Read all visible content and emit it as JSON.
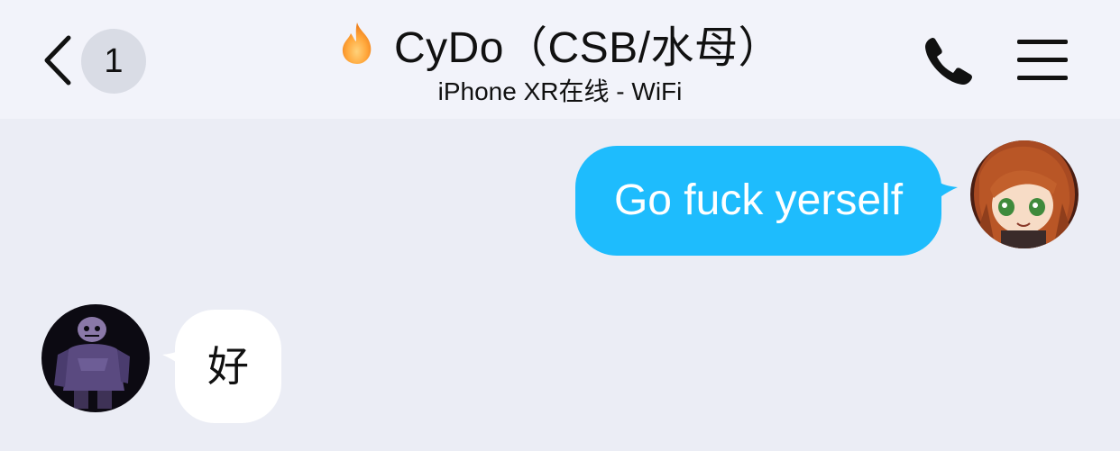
{
  "header": {
    "unread_count": "1",
    "contact_name": "CyDo（CSB/水母）",
    "status": "iPhone XR在线 - WiFi",
    "icons": {
      "back": "chevron-left-icon",
      "title_badge": "fire-icon",
      "call": "phone-icon",
      "menu": "hamburger-menu-icon"
    }
  },
  "messages": [
    {
      "sender": "me",
      "text": "Go fuck yerself"
    },
    {
      "sender": "other",
      "text": "好"
    }
  ],
  "colors": {
    "header_bg": "#f2f3fa",
    "chat_bg": "#ebedf5",
    "outgoing_bubble": "#1ebcfd",
    "incoming_bubble": "#ffffff",
    "badge_bg": "#d9dce5"
  }
}
